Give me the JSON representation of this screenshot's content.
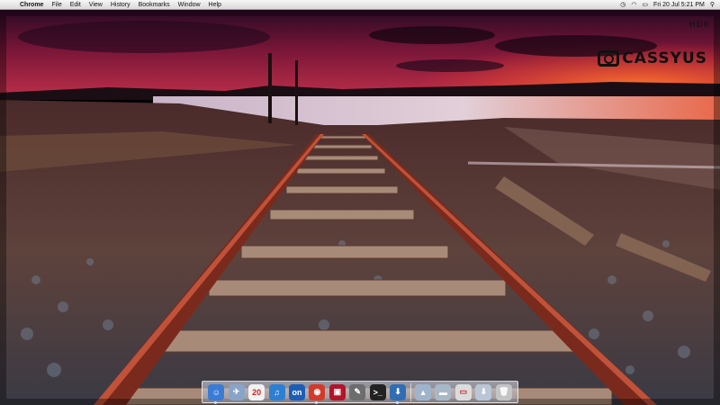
{
  "menubar": {
    "apple_glyph": "",
    "app_name": "Chrome",
    "menus": [
      "File",
      "Edit",
      "View",
      "History",
      "Bookmarks",
      "Window",
      "Help"
    ],
    "status_icons": [
      "time-machine-icon",
      "wifi-icon",
      "battery-icon"
    ],
    "clock": "Fri 20 Jul  5:21 PM",
    "spotlight_glyph": "⚲"
  },
  "wallpaper": {
    "watermark_letters": "HDR",
    "watermark_brand": "CASSYUS"
  },
  "dock": {
    "icons": [
      {
        "name": "finder-icon",
        "glyph": "☺",
        "color": "#3a7bd5",
        "running": true
      },
      {
        "name": "mail-icon",
        "glyph": "✈",
        "color": "#8aa4c8",
        "running": false
      },
      {
        "name": "ical-icon",
        "glyph": "20",
        "color": "#f2f2f2",
        "running": false
      },
      {
        "name": "itunes-icon",
        "glyph": "♫",
        "color": "#2d7fd2",
        "running": false
      },
      {
        "name": "on-app-icon",
        "glyph": "on",
        "color": "#1c5db8",
        "running": false
      },
      {
        "name": "chrome-icon",
        "glyph": "◉",
        "color": "#d23a2b",
        "running": true
      },
      {
        "name": "photo-booth-icon",
        "glyph": "▣",
        "color": "#b2142a",
        "running": false
      },
      {
        "name": "utility-icon",
        "glyph": "✎",
        "color": "#6d6d6d",
        "running": false
      },
      {
        "name": "terminal-icon",
        "glyph": ">_",
        "color": "#222222",
        "running": false
      },
      {
        "name": "app-store-icon",
        "glyph": "⬇",
        "color": "#2f6db5",
        "running": true
      }
    ],
    "stacks": [
      {
        "name": "applications-folder-icon",
        "glyph": "▲",
        "color": "#9fb4cc"
      },
      {
        "name": "documents-folder-icon",
        "glyph": "▬",
        "color": "#a9b8c8"
      },
      {
        "name": "screen-sharing-icon",
        "glyph": "▭",
        "color": "#dcdcdc"
      },
      {
        "name": "downloads-folder-icon",
        "glyph": "⬇",
        "color": "#b9c6d6"
      },
      {
        "name": "trash-icon",
        "glyph": "🗑",
        "color": "#c4c4c4"
      }
    ]
  },
  "colors": {
    "sky_top": "#3a0a2e",
    "sky_mid": "#8b1a3a",
    "horizon": "#ff5a2a",
    "water": "#d9c6d6",
    "ground": "#5a3a34",
    "rail": "#8a3020",
    "sleeper": "#a08070"
  }
}
